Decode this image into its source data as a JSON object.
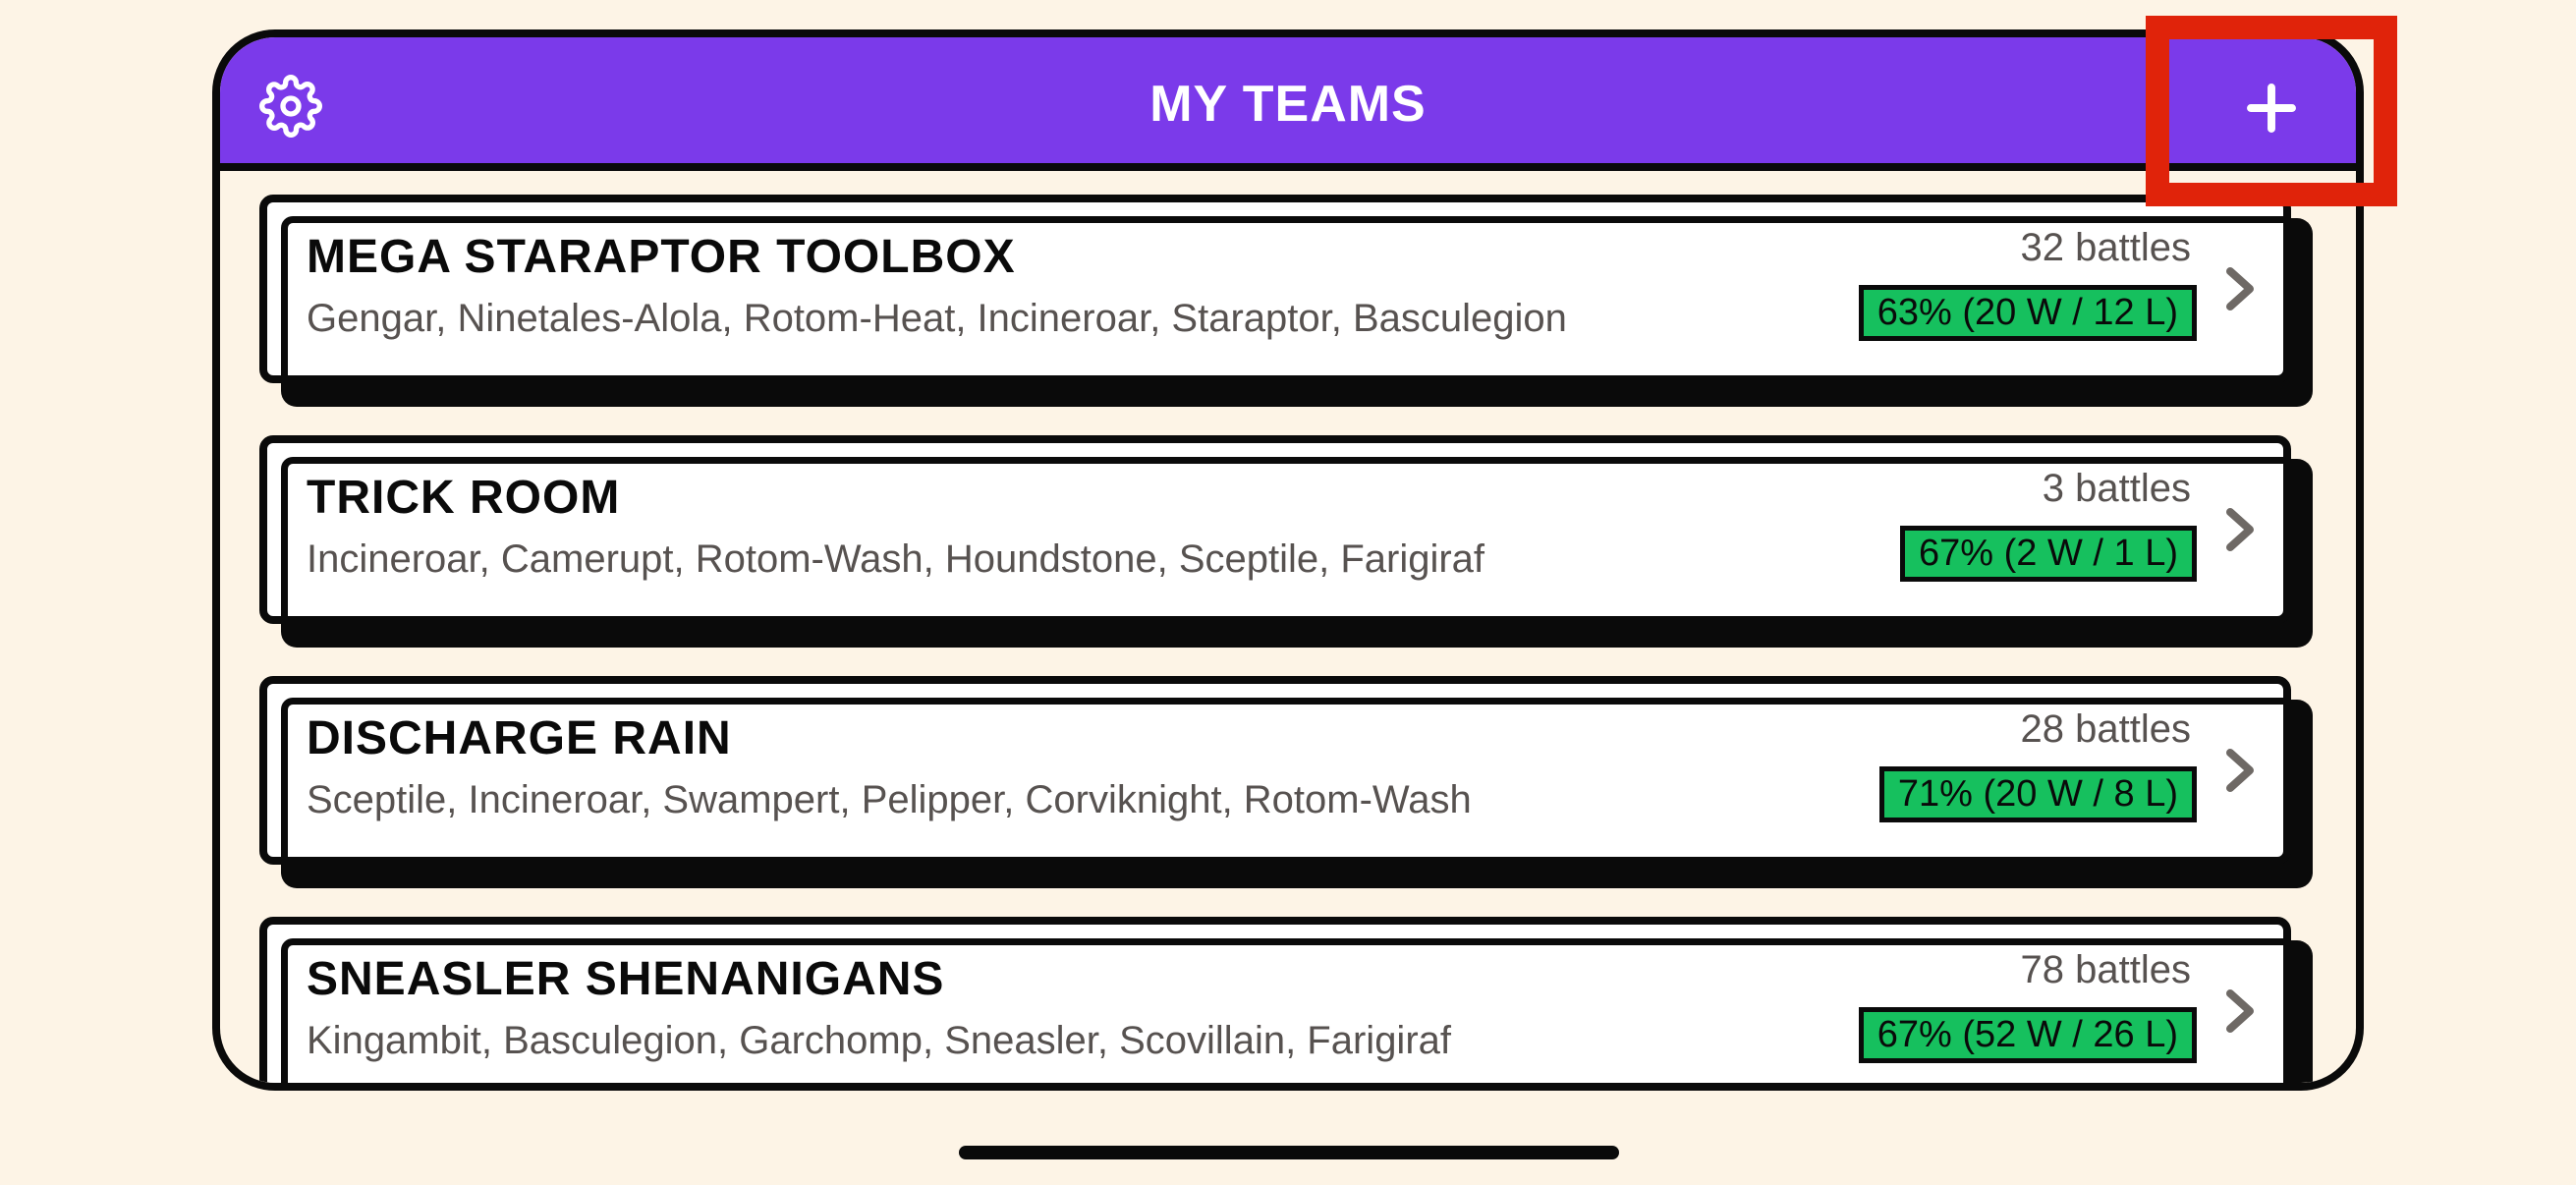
{
  "header": {
    "title": "MY TEAMS"
  },
  "teams": [
    {
      "name": "MEGA STARAPTOR TOOLBOX",
      "members": "Gengar, Ninetales-Alola, Rotom-Heat, Incineroar, Staraptor, Basculegion",
      "battles": "32 battles",
      "winrate": "63% (20 W / 12 L)"
    },
    {
      "name": "TRICK ROOM",
      "members": "Incineroar, Camerupt, Rotom-Wash, Houndstone, Sceptile, Farigiraf",
      "battles": "3 battles",
      "winrate": "67% (2 W / 1 L)"
    },
    {
      "name": "DISCHARGE RAIN",
      "members": "Sceptile, Incineroar, Swampert, Pelipper, Corviknight, Rotom-Wash",
      "battles": "28 battles",
      "winrate": "71% (20 W / 8 L)"
    },
    {
      "name": "SNEASLER SHENANIGANS",
      "members": "Kingambit, Basculegion, Garchomp, Sneasler, Scovillain, Farigiraf",
      "battles": "78 battles",
      "winrate": "67% (52 W / 26 L)"
    }
  ],
  "icons": {
    "settings": "gear-icon",
    "add": "plus-icon",
    "open_team": "chevron-right-icon"
  },
  "colors": {
    "header_bg": "#7b3aea",
    "win_badge": "#16c05e",
    "highlight": "#e0230a",
    "page_bg": "#fdf4e6"
  }
}
